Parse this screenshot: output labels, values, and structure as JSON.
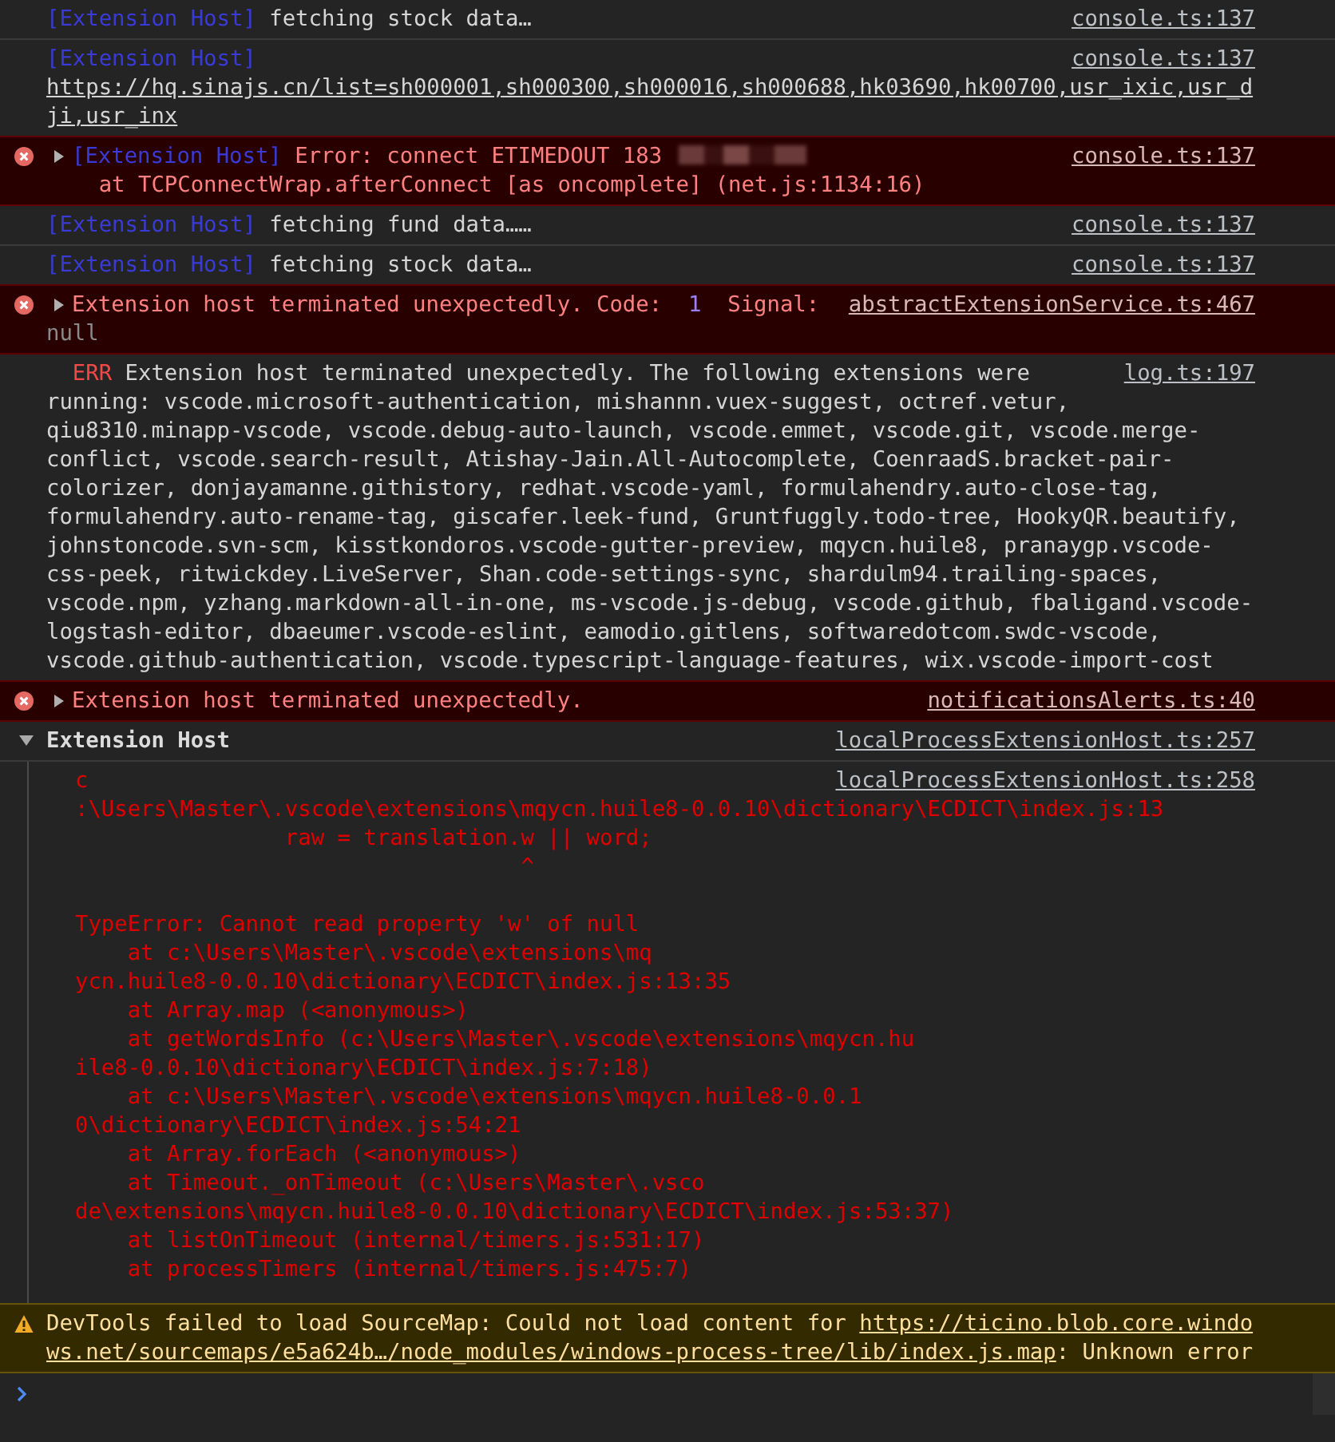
{
  "messages": [
    {
      "kind": "log",
      "prefix": "[Extension Host]",
      "lines": [
        "fetching stock data…"
      ],
      "source": "console.ts:137"
    },
    {
      "kind": "log",
      "prefix": "[Extension Host]",
      "link": "https://hq.sinajs.cn/list=sh000001,sh000300,sh000016,sh000688,hk03690,hk00700,usr_ixic,usr_dji,usr_inx",
      "source": "console.ts:137"
    },
    {
      "kind": "error",
      "expanded": false,
      "prefix": "[Extension Host]",
      "lines": [
        "Error: connect ETIMEDOUT 183"
      ],
      "redacted": true,
      "stack": [
        "    at TCPConnectWrap.afterConnect [as oncomplete] (net.js:1134:16)"
      ],
      "source": "console.ts:137"
    },
    {
      "kind": "log",
      "prefix": "[Extension Host]",
      "lines": [
        "fetching fund data……"
      ],
      "source": "console.ts:137"
    },
    {
      "kind": "log",
      "prefix": "[Extension Host]",
      "lines": [
        "fetching stock data…"
      ],
      "source": "console.ts:137"
    },
    {
      "kind": "exit-error",
      "expanded": false,
      "lines": [
        "Extension host terminated unexpectedly. Code:"
      ],
      "code": "1",
      "signal_label": "Signal:",
      "signal": "null",
      "source": "abstractExtensionService.ts:467"
    },
    {
      "kind": "err-log",
      "label": "ERR",
      "lines": [
        "Extension host terminated unexpectedly. The following extensions were",
        "running: vscode.microsoft-authentication, mishannn.vuex-suggest, octref.vetur,",
        "qiu8310.minapp-vscode, vscode.debug-auto-launch, vscode.emmet, vscode.git, vscode.merge-",
        "conflict, vscode.search-result, Atishay-Jain.All-Autocomplete, CoenraadS.bracket-pair-",
        "colorizer, donjayamanne.githistory, redhat.vscode-yaml, formulahendry.auto-close-tag,",
        "formulahendry.auto-rename-tag, giscafer.leek-fund, Gruntfuggly.todo-tree, HookyQR.beautify,",
        "johnstoncode.svn-scm, kisstkondoros.vscode-gutter-preview, mqycn.huile8, pranaygp.vscode-",
        "css-peek, ritwickdey.LiveServer, Shan.code-settings-sync, shardulm94.trailing-spaces,",
        "vscode.npm, yzhang.markdown-all-in-one, ms-vscode.js-debug, vscode.github, fbaligand.vscode-",
        "logstash-editor, dbaeumer.vscode-eslint, eamodio.gitlens, softwaredotcom.swdc-vscode,",
        "vscode.github-authentication, vscode.typescript-language-features, wix.vscode-import-cost"
      ],
      "source": "log.ts:197"
    },
    {
      "kind": "error",
      "expanded": false,
      "lines": [
        "Extension host terminated unexpectedly."
      ],
      "source": "notificationsAlerts.ts:40"
    },
    {
      "kind": "group",
      "expanded": true,
      "title": "Extension Host",
      "source": "localProcessExtensionHost.ts:257",
      "children": [
        {
          "kind": "stderr",
          "source": "localProcessExtensionHost.ts:258",
          "code_lines": [
            "c",
            ":\\Users\\Master\\.vscode\\extensions\\mqycn.huile8-0.0.10\\dictionary\\ECDICT\\index.js:13",
            "                raw = translation.w || word;",
            "                                  ^"
          ],
          "trace_lines": [
            "TypeError: Cannot read property 'w' of null",
            "    at c:\\Users\\Master\\.vscode\\extensions\\mq",
            "ycn.huile8-0.0.10\\dictionary\\ECDICT\\index.js:13:35",
            "    at Array.map (<anonymous>)",
            "    at getWordsInfo (c:\\Users\\Master\\.vscode\\extensions\\mqycn.hu",
            "ile8-0.0.10\\dictionary\\ECDICT\\index.js:7:18)",
            "    at c:\\Users\\Master\\.vscode\\extensions\\mqycn.huile8-0.0.1",
            "0\\dictionary\\ECDICT\\index.js:54:21",
            "    at Array.forEach (<anonymous>)",
            "    at Timeout._onTimeout (c:\\Users\\Master\\.vsco",
            "de\\extensions\\mqycn.huile8-0.0.10\\dictionary\\ECDICT\\index.js:53:37)",
            "    at listOnTimeout (internal/timers.js:531:17)",
            "    at processTimers (internal/timers.js:475:7)"
          ]
        }
      ]
    },
    {
      "kind": "warning",
      "text": "DevTools failed to load SourceMap: Could not load content for ",
      "link": "https://ticino.blob.core.windows.net/sourcemaps/e5a624b…/node_modules/windows-process-tree/lib/index.js.map",
      "after": ": Unknown error"
    }
  ]
}
